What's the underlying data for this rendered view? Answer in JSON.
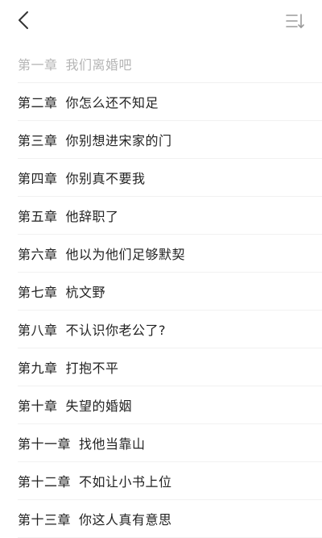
{
  "header": {
    "back_icon": "chevron-left-icon",
    "sort_icon": "sort-descending-icon"
  },
  "colors": {
    "read_text": "#b5b5b5",
    "text": "#222222",
    "divider": "#f1f1f1"
  },
  "chapters": [
    {
      "num": "第一章",
      "title": "我们离婚吧",
      "read": true
    },
    {
      "num": "第二章",
      "title": "你怎么还不知足",
      "read": false
    },
    {
      "num": "第三章",
      "title": "你别想进宋家的门",
      "read": false
    },
    {
      "num": "第四章",
      "title": "你别真不要我",
      "read": false
    },
    {
      "num": "第五章",
      "title": "他辞职了",
      "read": false
    },
    {
      "num": "第六章",
      "title": "他以为他们足够默契",
      "read": false
    },
    {
      "num": "第七章",
      "title": "杭文野",
      "read": false
    },
    {
      "num": "第八章",
      "title": "不认识你老公了?",
      "read": false
    },
    {
      "num": "第九章",
      "title": "打抱不平",
      "read": false
    },
    {
      "num": "第十章",
      "title": "失望的婚姻",
      "read": false
    },
    {
      "num": "第十一章",
      "title": "找他当靠山",
      "read": false
    },
    {
      "num": "第十二章",
      "title": "不如让小书上位",
      "read": false
    },
    {
      "num": "第十三章",
      "title": "你这人真有意思",
      "read": false
    }
  ]
}
